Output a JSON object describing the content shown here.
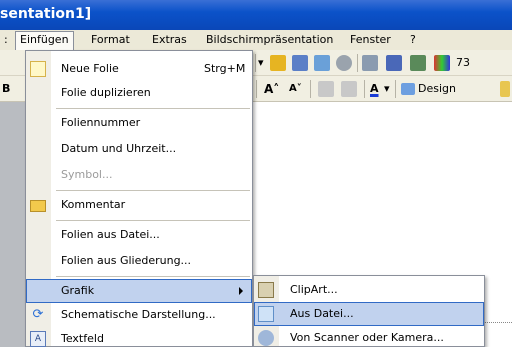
{
  "window": {
    "title_fragment": "sentation1]"
  },
  "menubar": {
    "items": [
      "Einfügen",
      "Format",
      "Extras",
      "Bildschirmpräsentation",
      "Fenster",
      "?"
    ],
    "left_fragment": ":"
  },
  "toolbar": {
    "zoom_fragment": "73",
    "design_label": "Design"
  },
  "insert_menu": {
    "items": [
      {
        "label": "Neue Folie",
        "shortcut": "Strg+M",
        "icon": "new-slide-icon",
        "disabled": false
      },
      {
        "label": "Folie duplizieren",
        "disabled": false
      },
      {
        "label": "Foliennummer",
        "disabled": false
      },
      {
        "label": "Datum und Uhrzeit...",
        "disabled": false
      },
      {
        "label": "Symbol...",
        "disabled": true
      },
      {
        "label": "Kommentar",
        "icon": "comment-folder-icon",
        "disabled": false
      },
      {
        "label": "Folien aus Datei...",
        "disabled": false
      },
      {
        "label": "Folien aus Gliederung...",
        "disabled": false
      },
      {
        "label": "Grafik",
        "has_submenu": true,
        "highlighted": true
      },
      {
        "label": "Schematische Darstellung...",
        "icon": "diagram-icon",
        "disabled": false
      },
      {
        "label": "Textfeld",
        "icon": "textbox-icon",
        "disabled": false
      }
    ]
  },
  "grafik_submenu": {
    "items": [
      {
        "label": "ClipArt...",
        "icon": "clipart-icon"
      },
      {
        "label": "Aus Datei...",
        "icon": "picture-from-file-icon",
        "highlighted": true
      },
      {
        "label": "Von Scanner oder Kamera...",
        "icon": "scanner-camera-icon"
      }
    ]
  },
  "colors": {
    "highlight_bg": "#c1d2ee",
    "highlight_border": "#316ac5",
    "titlebar": "#0b52c9",
    "menubar": "#ece9d8"
  }
}
